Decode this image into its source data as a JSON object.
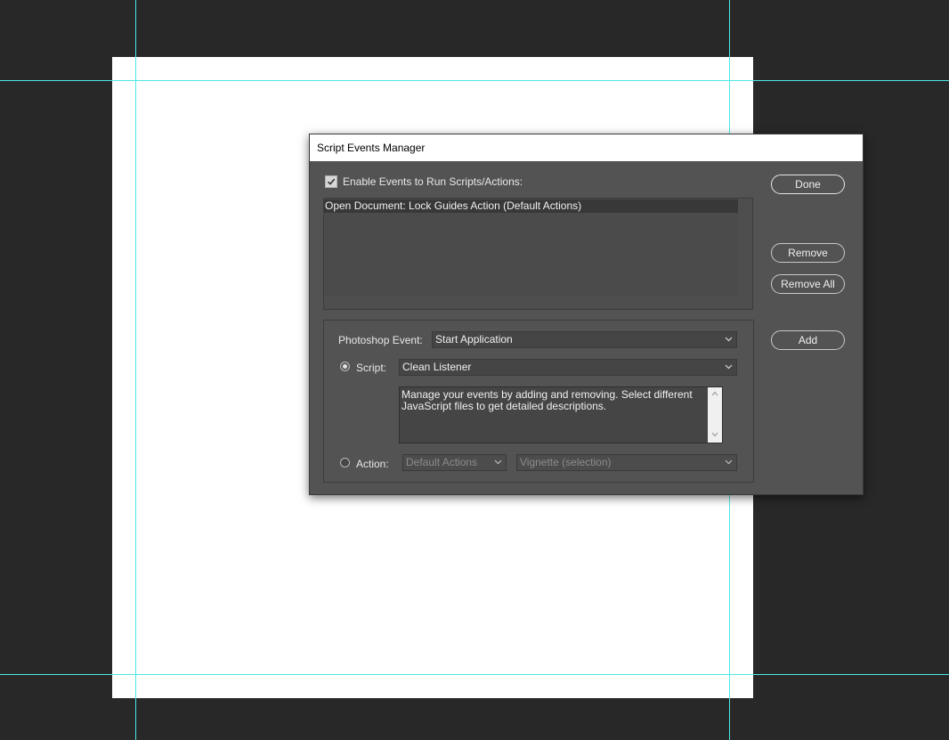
{
  "dialog": {
    "title": "Script Events Manager",
    "enable_label": "Enable Events to Run Scripts/Actions:",
    "enable_checked": true,
    "events": [
      "Open Document: Lock Guides Action (Default Actions)"
    ],
    "buttons": {
      "done": "Done",
      "remove": "Remove",
      "remove_all": "Remove All",
      "add": "Add"
    },
    "photoshop_event_label": "Photoshop Event:",
    "photoshop_event_value": "Start Application",
    "script_label": "Script:",
    "script_value": "Clean Listener",
    "script_selected": true,
    "description": "Manage your events by adding and removing. Select different JavaScript files to get detailed descriptions.",
    "action_label": "Action:",
    "action_set_value": "Default Actions",
    "action_value": "Vignette (selection)"
  },
  "colors": {
    "app_background": "#282828",
    "document": "#ffffff",
    "guides": "#4ee8e8",
    "dialog_background": "#535353"
  },
  "icons": {
    "checkmark": "checkmark-icon",
    "dropdown": "chevron-down-icon",
    "scroll_up": "chevron-up-icon",
    "scroll_down": "chevron-down-icon"
  }
}
